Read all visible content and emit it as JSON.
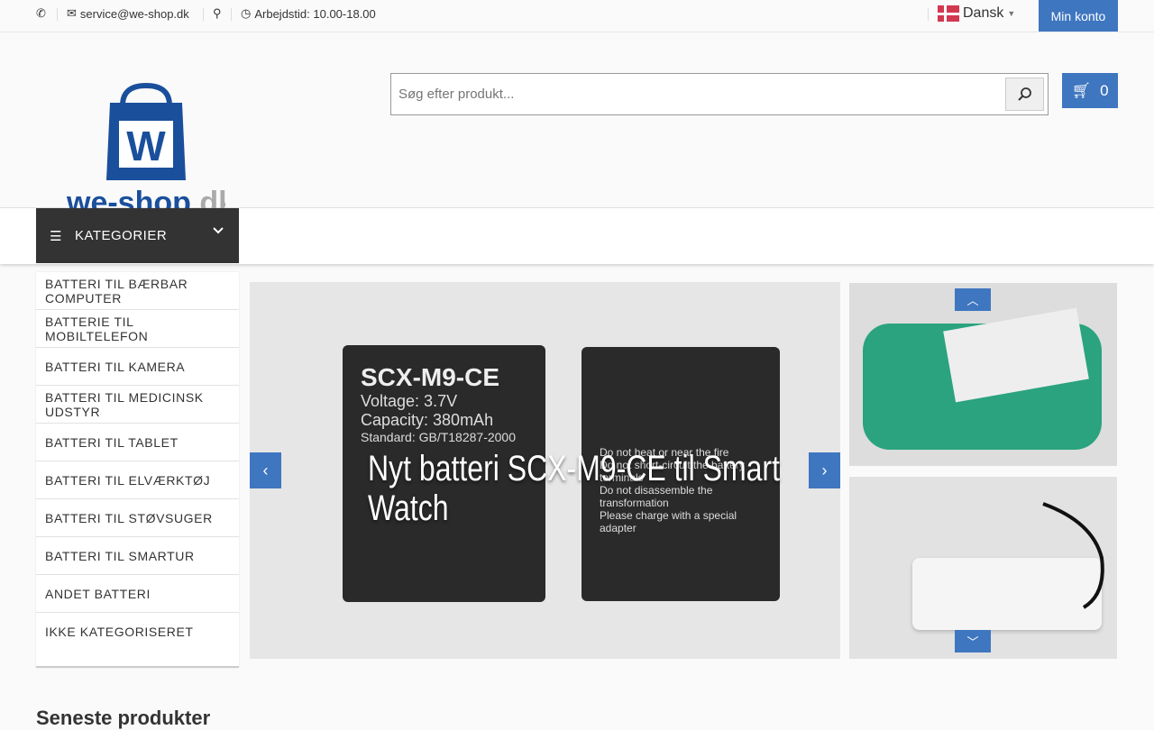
{
  "topbar": {
    "email": "service@we-shop.dk",
    "hours": "Arbejdstid: 10.00-18.00",
    "language": "Dansk",
    "account": "Min konto"
  },
  "header": {
    "logo_text": "we-shop.dk",
    "search_placeholder": "Søg efter produkt...",
    "cart_count": "0"
  },
  "nav": {
    "categories_label": "KATEGORIER"
  },
  "menu": [
    "BATTERI TIL BÆRBAR COMPUTER",
    "BATTERIE TIL MOBILTELEFON",
    "BATTERI TIL KAMERA",
    "BATTERI TIL MEDICINSK UDSTYR",
    "BATTERI TIL TABLET",
    "BATTERI TIL ELVÆRKTØJ",
    "BATTERI TIL STØVSUGER",
    "BATTERI TIL SMARTUR",
    "ANDET BATTERI",
    "IKKE KATEGORISERET"
  ],
  "slider": {
    "title": "Nyt batteri SCX-M9-CE til Smart Watch",
    "battery_label": "SCX-M9-CE",
    "battery_lines": [
      "Voltage: 3.7V",
      "Capacity: 380mAh",
      "Standard: GB/T18287-2000"
    ],
    "back_lines": [
      "Do not heat or near the fire",
      "Do not short-circuit the battery terminals",
      "Do not disassemble the transformation",
      "Please charge with a special adapter"
    ]
  },
  "section": {
    "latest_title": "Seneste produkter"
  },
  "colors": {
    "accent": "#3f76c0",
    "dark": "#333333"
  }
}
